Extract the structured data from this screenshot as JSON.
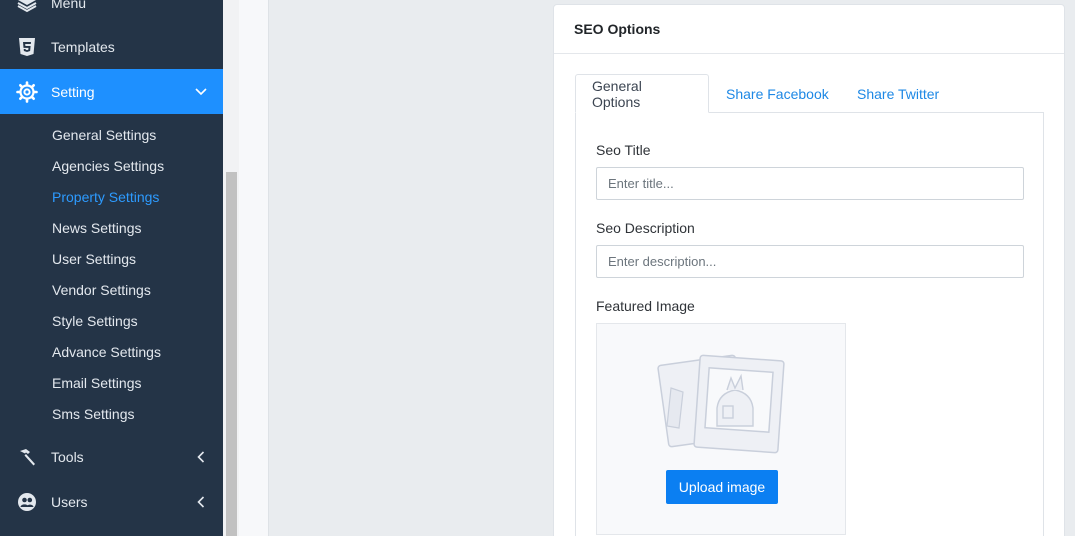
{
  "sidebar": {
    "items": [
      {
        "label": "Menu",
        "icon": "layers-icon"
      },
      {
        "label": "Templates",
        "icon": "html5-icon"
      },
      {
        "label": "Setting",
        "icon": "gear-icon",
        "active": true
      },
      {
        "label": "Tools",
        "icon": "hammer-icon"
      },
      {
        "label": "Users",
        "icon": "users-icon"
      }
    ],
    "sub_items": [
      {
        "label": "General Settings"
      },
      {
        "label": "Agencies Settings"
      },
      {
        "label": "Property Settings",
        "current": true
      },
      {
        "label": "News Settings"
      },
      {
        "label": "User Settings"
      },
      {
        "label": "Vendor Settings"
      },
      {
        "label": "Style Settings"
      },
      {
        "label": "Advance Settings"
      },
      {
        "label": "Email Settings"
      },
      {
        "label": "Sms Settings"
      }
    ],
    "colors": {
      "background": "#243447",
      "active": "#1e90ff",
      "current_link": "#2d9bff"
    }
  },
  "seo": {
    "title": "SEO Options",
    "tabs": [
      {
        "label": "General Options",
        "active": true
      },
      {
        "label": "Share Facebook"
      },
      {
        "label": "Share Twitter"
      }
    ],
    "seo_title_label": "Seo Title",
    "seo_title_placeholder": "Enter title...",
    "seo_title_value": "",
    "seo_description_label": "Seo Description",
    "seo_description_placeholder": "Enter description...",
    "seo_description_value": "",
    "featured_image_label": "Featured Image",
    "upload_button": "Upload image"
  }
}
